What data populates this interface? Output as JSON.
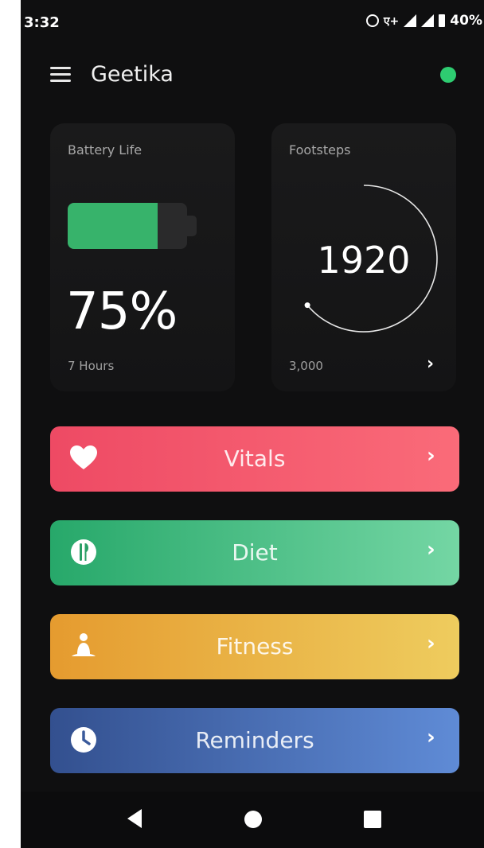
{
  "status_bar": {
    "time": "3:32",
    "network": "ए+",
    "battery_percent": "40%"
  },
  "app_bar": {
    "user_name": "Geetika",
    "online_color": "#2ecc71"
  },
  "battery_card": {
    "title": "Battery Life",
    "level_fraction": 0.75,
    "percent_text": "75%",
    "subtitle": "7 Hours",
    "fill_color": "#37b36b"
  },
  "steps_card": {
    "title": "Footsteps",
    "count": "1920",
    "goal_text": "3,000",
    "progress_fraction": 0.64,
    "arrow": "›"
  },
  "menu": [
    {
      "key": "vitals",
      "label": "Vitals",
      "icon": "heart-icon",
      "chevron": "›"
    },
    {
      "key": "diet",
      "label": "Diet",
      "icon": "plate-cutlery-icon",
      "chevron": "›"
    },
    {
      "key": "fitness",
      "label": "Fitness",
      "icon": "meditation-person-icon",
      "chevron": "›"
    },
    {
      "key": "reminders",
      "label": "Reminders",
      "icon": "clock-icon",
      "chevron": "›"
    }
  ],
  "nav_bar": {
    "back": "back-icon",
    "home": "home-icon",
    "recents": "recents-icon"
  }
}
